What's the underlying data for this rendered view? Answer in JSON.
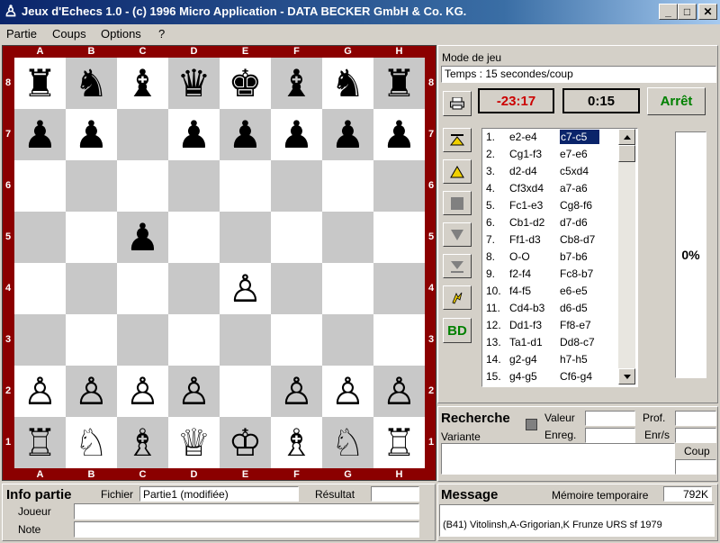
{
  "window": {
    "title": "Jeux d'Echecs 1.0 - (c) 1996 Micro Application - DATA BECKER GmbH & Co. KG.",
    "minimize": "_",
    "maximize": "□",
    "close": "✕"
  },
  "menu": [
    "Partie",
    "Coups",
    "Options",
    "?"
  ],
  "board": {
    "files": [
      "A",
      "B",
      "C",
      "D",
      "E",
      "F",
      "G",
      "H"
    ],
    "ranks": [
      "8",
      "7",
      "6",
      "5",
      "4",
      "3",
      "2",
      "1"
    ],
    "colors": {
      "frame": "#8b0000",
      "light": "#ffffff",
      "dark": "#c8c8c8"
    },
    "squares": [
      [
        "♜",
        "♞",
        "♝",
        "♛",
        "♚",
        "♝",
        "♞",
        "♜"
      ],
      [
        "♟",
        "♟",
        "",
        "♟",
        "♟",
        "♟",
        "♟",
        "♟"
      ],
      [
        "",
        "",
        "",
        "",
        "",
        "",
        "",
        ""
      ],
      [
        "",
        "",
        "♟",
        "",
        "",
        "",
        "",
        ""
      ],
      [
        "",
        "",
        "",
        "",
        "♙",
        "",
        "",
        ""
      ],
      [
        "",
        "",
        "",
        "",
        "",
        "",
        "",
        ""
      ],
      [
        "♙",
        "♙",
        "♙",
        "♙",
        "",
        "♙",
        "♙",
        "♙"
      ],
      [
        "♖",
        "♘",
        "♗",
        "♕",
        "♔",
        "♗",
        "♘",
        "♖"
      ]
    ]
  },
  "game_mode": {
    "label": "Mode de jeu",
    "value": "Temps : 15 secondes/coup"
  },
  "clocks": {
    "white_time": "-23:17",
    "black_time": "0:15",
    "white_color": "#cc0000",
    "stop_label": "Arrêt",
    "stop_color": "#008000"
  },
  "side_buttons": {
    "print_icon": "printer-icon",
    "first_icon": "first-move-icon",
    "back_icon": "back-move-icon",
    "stop_icon": "stop-square-icon",
    "forward_icon": "forward-move-icon",
    "last_icon": "last-move-icon",
    "hint_icon": "hint-icon",
    "bd_label": "BD",
    "bd_color": "#008000"
  },
  "moves": [
    {
      "n": "1.",
      "w": "e2-e4",
      "b": "c7-c5"
    },
    {
      "n": "2.",
      "w": "Cg1-f3",
      "b": "e7-e6"
    },
    {
      "n": "3.",
      "w": "d2-d4",
      "b": "c5xd4"
    },
    {
      "n": "4.",
      "w": "Cf3xd4",
      "b": "a7-a6"
    },
    {
      "n": "5.",
      "w": "Fc1-e3",
      "b": "Cg8-f6"
    },
    {
      "n": "6.",
      "w": "Cb1-d2",
      "b": "d7-d6"
    },
    {
      "n": "7.",
      "w": "Ff1-d3",
      "b": "Cb8-d7"
    },
    {
      "n": "8.",
      "w": "O-O",
      "b": "b7-b6"
    },
    {
      "n": "9.",
      "w": "f2-f4",
      "b": "Fc8-b7"
    },
    {
      "n": "10.",
      "w": "f4-f5",
      "b": "e6-e5"
    },
    {
      "n": "11.",
      "w": "Cd4-b3",
      "b": "d6-d5"
    },
    {
      "n": "12.",
      "w": "Dd1-f3",
      "b": "Ff8-e7"
    },
    {
      "n": "13.",
      "w": "Ta1-d1",
      "b": "Dd8-c7"
    },
    {
      "n": "14.",
      "w": "g2-g4",
      "b": "h7-h5"
    },
    {
      "n": "15.",
      "w": "g4-g5",
      "b": "Cf6-g4"
    }
  ],
  "progress": {
    "value": 0,
    "label": "0%"
  },
  "search": {
    "title": "Recherche",
    "variante": "Variante",
    "valeur": "Valeur",
    "enreg": "Enreg.",
    "prof": "Prof.",
    "enrs": "Enr/s",
    "coup": "Coup"
  },
  "info": {
    "title": "Info partie",
    "fichier_label": "Fichier",
    "fichier_value": "Partie1 (modifiée)",
    "resultat_label": "Résultat",
    "joueur_label": "Joueur",
    "note_label": "Note"
  },
  "message": {
    "title": "Message",
    "memory_label": "Mémoire temporaire",
    "memory_value": "792K",
    "text": "(B41)  Vitolinsh,A-Grigorian,K Frunze URS sf 1979"
  }
}
